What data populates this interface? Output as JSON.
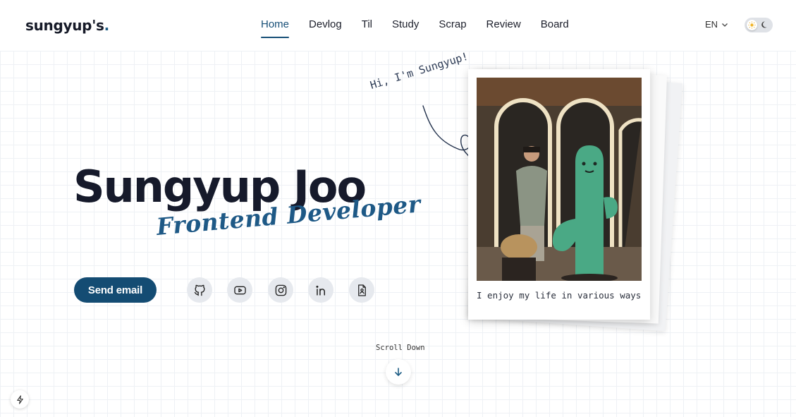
{
  "header": {
    "logo_text": "sungyup's",
    "logo_dot": ".",
    "nav": [
      {
        "label": "Home",
        "active": true
      },
      {
        "label": "Devlog",
        "active": false
      },
      {
        "label": "Til",
        "active": false
      },
      {
        "label": "Study",
        "active": false
      },
      {
        "label": "Scrap",
        "active": false
      },
      {
        "label": "Review",
        "active": false
      },
      {
        "label": "Board",
        "active": false
      }
    ],
    "language": "EN",
    "theme": "light"
  },
  "hero": {
    "greeting": "Hi, I'm Sungyup!",
    "name": "Sungyup Joo",
    "role": "Frontend Developer",
    "send_email_label": "Send email",
    "socials": [
      {
        "name": "github",
        "icon": "github-icon"
      },
      {
        "name": "youtube",
        "icon": "youtube-icon"
      },
      {
        "name": "instagram",
        "icon": "instagram-icon"
      },
      {
        "name": "linkedin",
        "icon": "linkedin-icon"
      },
      {
        "name": "resume",
        "icon": "resume-icon"
      }
    ]
  },
  "polaroid": {
    "caption": "I enjoy my life in various ways"
  },
  "scroll": {
    "label": "Scroll Down"
  },
  "colors": {
    "accent": "#144c73",
    "nav_active": "#174f77",
    "role_text": "#1e5986",
    "grid": "#eef1f5"
  }
}
